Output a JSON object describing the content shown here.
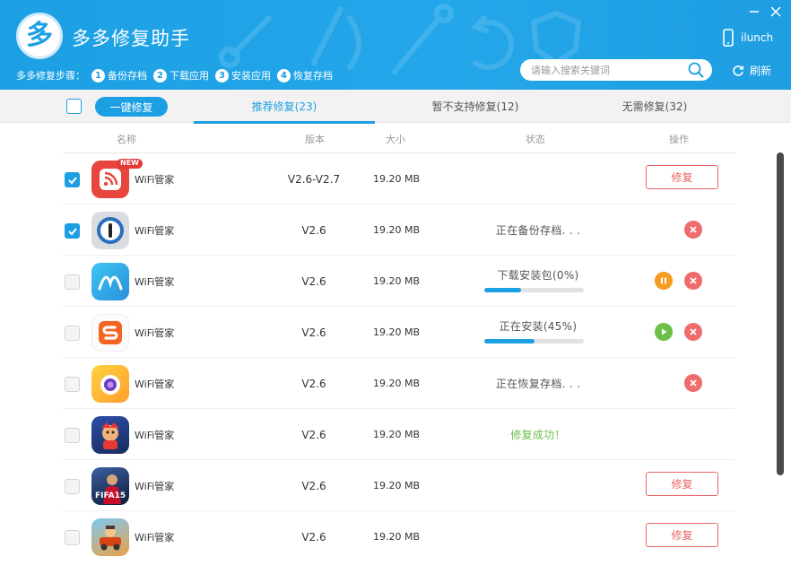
{
  "app": {
    "title": "多多修复助手",
    "logo_char": "多",
    "device_name": "ilunch",
    "refresh_label": "刷新",
    "search_placeholder": "请输入搜索关键词",
    "accent_color": "#1d9fe3"
  },
  "steps": {
    "label": "多多修复步骤：",
    "items": [
      {
        "num": "1",
        "label": "备份存档"
      },
      {
        "num": "2",
        "label": "下载应用"
      },
      {
        "num": "3",
        "label": "安装应用"
      },
      {
        "num": "4",
        "label": "恢复存档"
      }
    ]
  },
  "toolbar": {
    "repair_all_label": "一键修复",
    "tabs": [
      {
        "label": "推荐修复(23)",
        "active": true
      },
      {
        "label": "暂不支持修复(12)",
        "active": false
      },
      {
        "label": "无需修复(32)",
        "active": false
      }
    ]
  },
  "columns": {
    "name": "名称",
    "version": "版本",
    "size": "大小",
    "status": "状态",
    "action": "操作"
  },
  "rows": [
    {
      "checked": true,
      "icon": "wifi-manager-icon",
      "badge": "NEW",
      "name": "WiFi管家",
      "version": "V2.6-V2.7",
      "size": "19.20 MB",
      "status": "",
      "action_label": "修复"
    },
    {
      "checked": true,
      "icon": "1password-icon",
      "name": "WiFi管家",
      "version": "V2.6",
      "size": "19.20 MB",
      "status": "正在备份存档. . .",
      "actions": [
        "cancel-icon"
      ]
    },
    {
      "checked": false,
      "icon": "swiftkey-icon",
      "name": "WiFi管家",
      "version": "V2.6",
      "size": "19.20 MB",
      "status": "下载安装包(0%)",
      "progress": 0.37,
      "actions": [
        "pause-icon",
        "cancel-icon"
      ]
    },
    {
      "checked": false,
      "icon": "sogou-icon",
      "name": "WiFi管家",
      "version": "V2.6",
      "size": "19.20 MB",
      "status": "正在安装(45%)",
      "progress": 0.5,
      "actions": [
        "play-icon",
        "cancel-icon"
      ]
    },
    {
      "checked": false,
      "icon": "camera-icon",
      "name": "WiFi管家",
      "version": "V2.6",
      "size": "19.20 MB",
      "status": "正在恢复存档. . .",
      "actions": [
        "cancel-icon"
      ]
    },
    {
      "checked": false,
      "icon": "game-icon",
      "name": "WiFi管家",
      "version": "V2.6",
      "size": "19.20 MB",
      "status": "修复成功！",
      "status_type": "success"
    },
    {
      "checked": false,
      "icon": "fifa-icon",
      "name": "WiFi管家",
      "version": "V2.6",
      "size": "19.20 MB",
      "status": "",
      "action_label": "修复"
    },
    {
      "checked": false,
      "icon": "racing-game-icon",
      "name": "WiFi管家",
      "version": "V2.6",
      "size": "19.20 MB",
      "status": "",
      "action_label": "修复"
    }
  ],
  "icon_fifa_text": "FIFA15"
}
